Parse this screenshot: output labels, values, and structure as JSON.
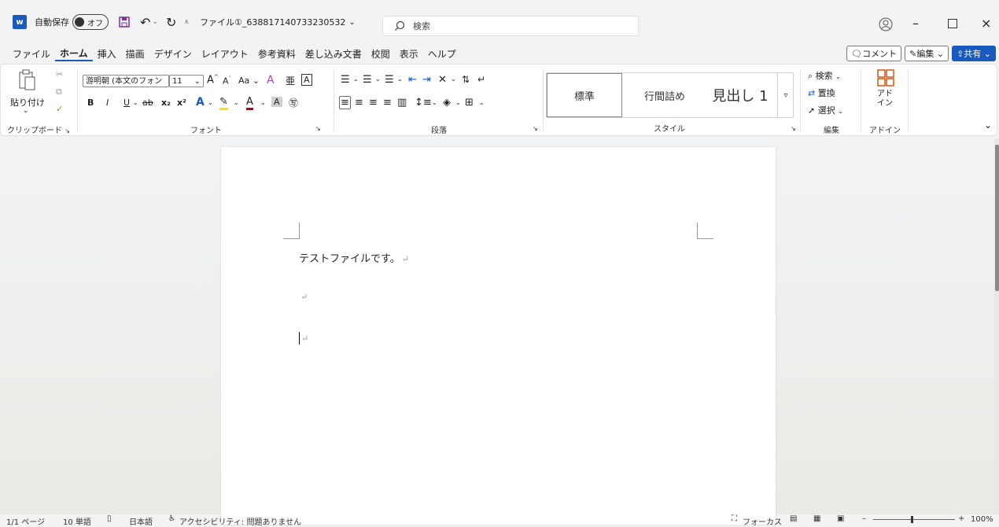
{
  "titlebar": {
    "autosave_label": "自動保存",
    "autosave_state": "オフ",
    "file_name": "ファイル①_638817140733230532",
    "search_placeholder": "検索"
  },
  "menu": {
    "items": [
      "ファイル",
      "ホーム",
      "挿入",
      "描画",
      "デザイン",
      "レイアウト",
      "参考資料",
      "差し込み文書",
      "校閲",
      "表示",
      "ヘルプ"
    ],
    "active": "ホーム",
    "comment_label": "コメント",
    "edit_label": "編集",
    "share_label": "共有"
  },
  "ribbon": {
    "clipboard": {
      "paste_label": "貼り付け",
      "group_label": "クリップボード"
    },
    "font": {
      "font_name": "游明朝 (本文のフォン",
      "font_size": "11",
      "grow": "A",
      "shrink": "A",
      "case": "Aa",
      "bold": "B",
      "italic": "I",
      "underline": "U",
      "strike": "ab",
      "subscript": "x₂",
      "superscript": "x²",
      "group_label": "フォント"
    },
    "paragraph": {
      "group_label": "段落"
    },
    "styles": {
      "items": [
        "標準",
        "行間詰め",
        "見出し 1"
      ],
      "group_label": "スタイル"
    },
    "editing": {
      "find_label": "検索",
      "replace_label": "置換",
      "select_label": "選択",
      "group_label": "編集"
    },
    "addins": {
      "button_label": "アド\nイン",
      "group_label": "アドイン"
    }
  },
  "document": {
    "lines": [
      "テストファイルです。",
      "",
      ""
    ],
    "para_mark": "↵"
  },
  "statusbar": {
    "page": "1/1 ページ",
    "words": "10 単語",
    "language": "日本語",
    "accessibility": "アクセシビリティ: 問題ありません",
    "focus": "フォーカス",
    "zoom": "100%"
  },
  "colors": {
    "accent": "#185abd",
    "red_text": "#c00000",
    "highlight": "#ffe000"
  }
}
